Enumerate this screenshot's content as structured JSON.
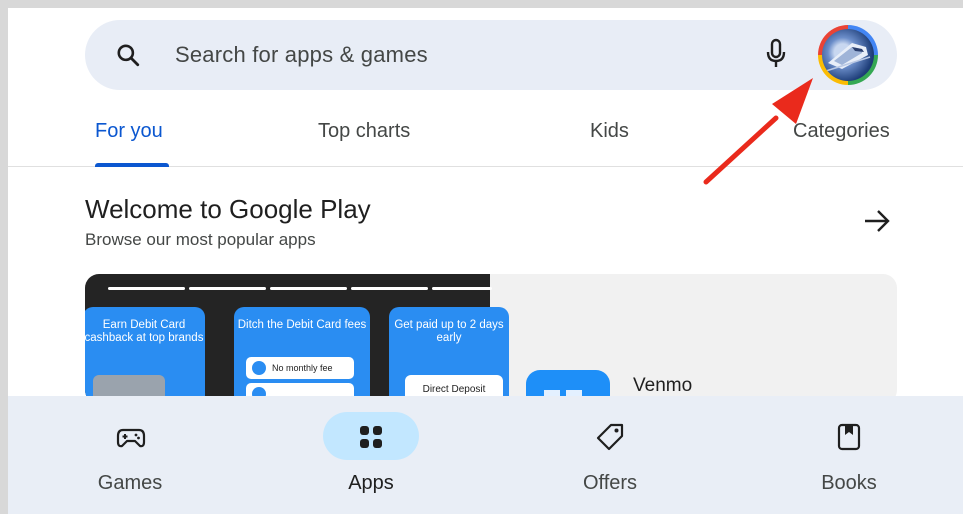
{
  "search": {
    "placeholder": "Search for apps & games"
  },
  "tabs": [
    {
      "label": "For you"
    },
    {
      "label": "Top charts"
    },
    {
      "label": "Kids"
    },
    {
      "label": "Categories"
    }
  ],
  "section": {
    "title": "Welcome to Google Play",
    "subtitle": "Browse our most popular apps"
  },
  "featured": {
    "promos": [
      "Earn Debit Card cashback at top brands",
      "Ditch the Debit Card fees",
      "Get paid up to 2 days early"
    ],
    "pill_label": "No monthly fee",
    "direct_deposit": "Direct Deposit",
    "app_name": "Venmo"
  },
  "bottom_nav": [
    {
      "label": "Games",
      "icon": "gamepad-icon"
    },
    {
      "label": "Apps",
      "icon": "apps-grid-icon"
    },
    {
      "label": "Offers",
      "icon": "tag-icon"
    },
    {
      "label": "Books",
      "icon": "bookmark-icon"
    }
  ],
  "colors": {
    "accent": "#0b57d0",
    "search_bg": "#e8edf6",
    "nav_bg": "#e9eef6",
    "active_pill": "#c2e7ff",
    "annotation_arrow": "#ea2a1c"
  }
}
